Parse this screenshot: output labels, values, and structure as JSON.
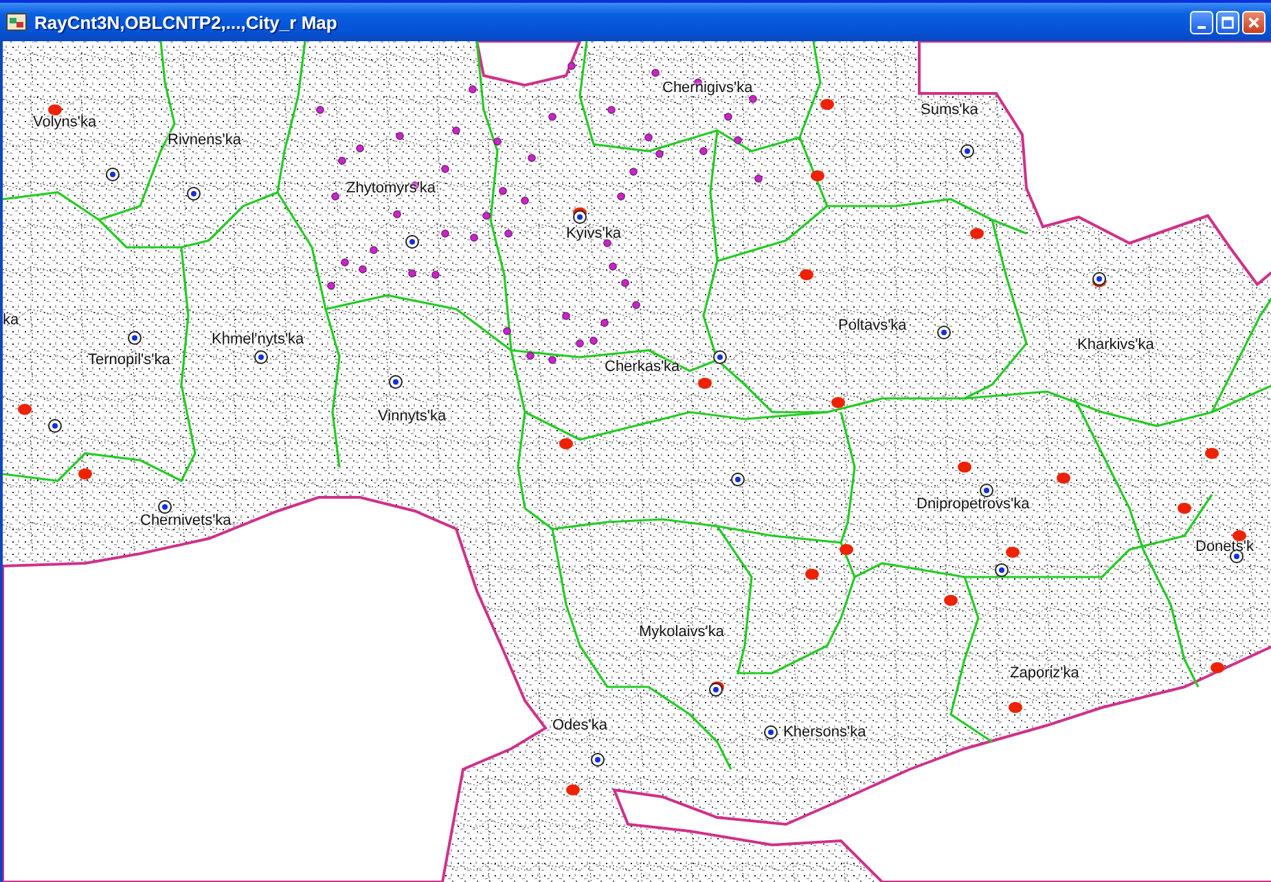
{
  "window": {
    "title": "RayCnt3N,OBLCNTP2,...,City_r Map"
  },
  "map": {
    "labels": [
      {
        "text": "Volyns'ka"
      },
      {
        "text": "Chernigivs'ka"
      },
      {
        "text": "Sums'ka"
      },
      {
        "text": "Rivnens'ka"
      },
      {
        "text": "Zhytomyrs'ka"
      },
      {
        "text": "Kyivs'ka"
      },
      {
        "text": "ka"
      },
      {
        "text": "Poltavs'ka"
      },
      {
        "text": "Khmel'nyts'ka"
      },
      {
        "text": "Kharkivs'ka"
      },
      {
        "text": "Ternopil's'ka"
      },
      {
        "text": "Cherkas'ka"
      },
      {
        "text": "Vinnyts'ka"
      },
      {
        "text": "Dnipropetrovs'ka"
      },
      {
        "text": "Chernivets'ka"
      },
      {
        "text": "Donets'k"
      },
      {
        "text": "Mykolaivs'ka"
      },
      {
        "text": "Zaporiz'ka"
      },
      {
        "text": "Odes'ka"
      },
      {
        "text": "Khersons'ka"
      }
    ]
  }
}
